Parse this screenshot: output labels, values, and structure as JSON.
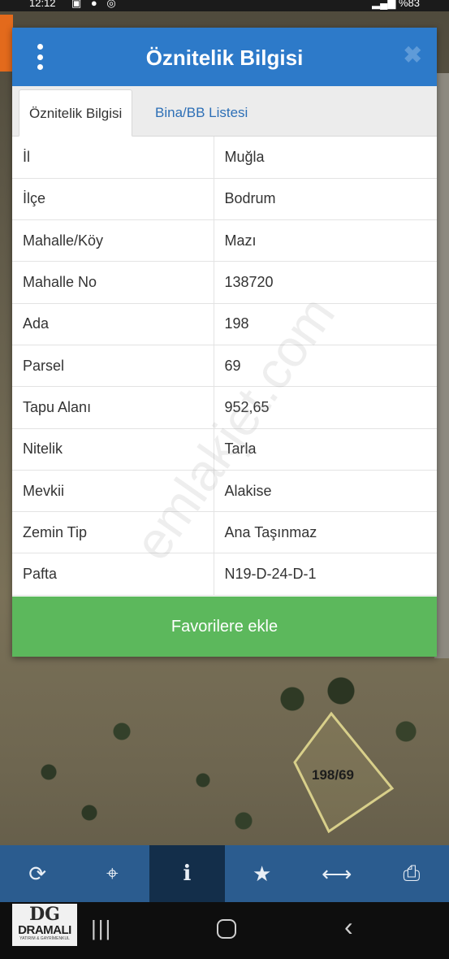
{
  "status_bar": {
    "time": "12:12",
    "battery": "%83"
  },
  "dialog": {
    "title": "Öznitelik Bilgisi",
    "close_label": "✖",
    "tabs": [
      {
        "label": "Öznitelik Bilgisi",
        "active": true
      },
      {
        "label": "Bina/BB Listesi",
        "active": false
      }
    ],
    "rows": [
      {
        "key": "İl",
        "value": "Muğla"
      },
      {
        "key": "İlçe",
        "value": "Bodrum"
      },
      {
        "key": "Mahalle/Köy",
        "value": "Mazı"
      },
      {
        "key": "Mahalle No",
        "value": "138720"
      },
      {
        "key": "Ada",
        "value": "198"
      },
      {
        "key": "Parsel",
        "value": "69"
      },
      {
        "key": "Tapu Alanı",
        "value": "952,65"
      },
      {
        "key": "Nitelik",
        "value": "Tarla"
      },
      {
        "key": "Mevkii",
        "value": "Alakise"
      },
      {
        "key": "Zemin Tip",
        "value": "Ana Taşınmaz"
      },
      {
        "key": "Pafta",
        "value": "N19-D-24-D-1"
      }
    ],
    "favorite_button": "Favorilere ekle"
  },
  "watermark": "emlakjet.com",
  "map": {
    "parcel_label": "198/69"
  },
  "toolbar": {
    "items": [
      {
        "name": "refresh-icon",
        "glyph": "⟳"
      },
      {
        "name": "locate-icon",
        "glyph": "⌖"
      },
      {
        "name": "info-icon",
        "glyph": "i",
        "active": true
      },
      {
        "name": "star-icon",
        "glyph": "★"
      },
      {
        "name": "measure-icon",
        "glyph": "⟷"
      },
      {
        "name": "print-icon",
        "glyph": "⎙"
      }
    ]
  },
  "logo": {
    "mark": "DG",
    "brand": "DRAMALI",
    "tagline": "YATIRIM & GAYRİMENKUL"
  },
  "colors": {
    "header": "#2d7ac9",
    "favorite": "#5cb85c",
    "toolbar": "#2b5c8f"
  }
}
